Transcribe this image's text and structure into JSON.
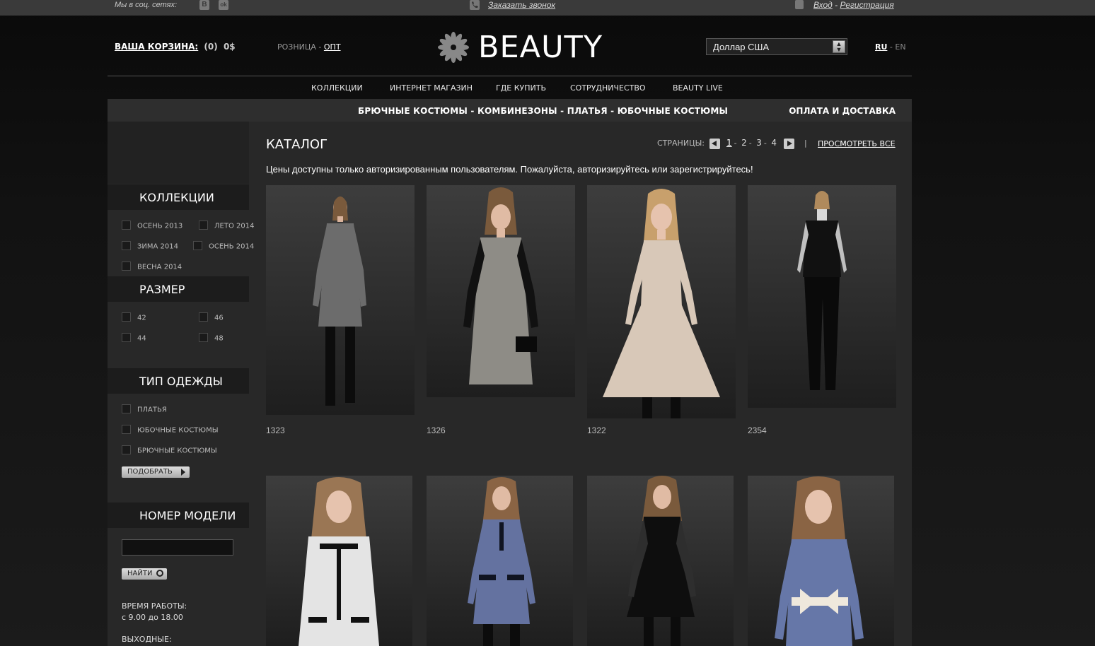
{
  "topbar": {
    "social_label": "Мы в соц. сетях:",
    "social_icons": [
      "В",
      "ok"
    ],
    "callback": "Заказать звонок",
    "login": "Вход",
    "separator": "-",
    "register": "Регистрация"
  },
  "header": {
    "cart_label": "ВАША КОРЗИНА:",
    "cart_count": "(0)",
    "cart_total": "0$",
    "retail": "РОЗНИЦА",
    "retail_sep": " - ",
    "wholesale": "ОПТ",
    "logo": "BEAUTY",
    "currency": "Доллар США",
    "lang_ru": "RU",
    "lang_sep": " - ",
    "lang_en": "EN"
  },
  "nav": [
    "КОЛЛЕКЦИИ",
    "ИНТЕРНЕТ МАГАЗИН",
    "ГДЕ КУПИТЬ",
    "СОТРУДНИЧЕСТВО",
    "BEAUTY LIVE"
  ],
  "categories": {
    "links": "БРЮЧНЫЕ КОСТЮМЫ - КОМБИНЕЗОНЫ - ПЛАТЬЯ - ЮБОЧНЫЕ КОСТЮМЫ",
    "delivery": "ОПЛАТА И ДОСТАВКА"
  },
  "sidebar": {
    "collections_title": "КОЛЛЕКЦИИ",
    "collections": [
      "ОСЕНЬ 2013",
      "ЛЕТО 2014",
      "ЗИМА 2014",
      "ОСЕНЬ 2014",
      "ВЕСНА 2014"
    ],
    "size_title": "РАЗМЕР",
    "sizes": [
      "42",
      "46",
      "44",
      "48"
    ],
    "type_title": "ТИП ОДЕЖДЫ",
    "types": [
      "ПЛАТЬЯ",
      "ЮБОЧНЫЕ КОСТЮМЫ",
      "БРЮЧНЫЕ КОСТЮМЫ"
    ],
    "pick_button": "ПОДОБРАТЬ",
    "model_title": "НОМЕР МОДЕЛИ",
    "model_input_value": "",
    "find_button": "НАЙТИ",
    "hours_label": "ВРЕМЯ РАБОТЫ:",
    "hours_value": "с 9.00 до 18.00",
    "weekend_label": "ВЫХОДНЫЕ:"
  },
  "catalog": {
    "title": "КАТАЛОГ",
    "pages_label": "СТРАНИЦЫ:",
    "pages": [
      "1",
      "2",
      "3",
      "4"
    ],
    "pages_sep": "-",
    "pages_bar": "|",
    "view_all": "ПРОСМОТРЕТЬ ВСЕ",
    "notice": "Цены доступны только авторизированным пользователям. Пожалуйста, авторизируйтесь или зарегистрируйтесь!",
    "products": [
      {
        "sku": "1323",
        "dress_color": "#6c6c6c",
        "style": "grey-shift"
      },
      {
        "sku": "1326",
        "dress_color": "#8e8c86",
        "style": "leather-sleeves"
      },
      {
        "sku": "1322",
        "dress_color": "#d8c8b8",
        "style": "beige-flare"
      },
      {
        "sku": "2354",
        "dress_color": "#111111",
        "style": "black-trousers"
      },
      {
        "sku": "",
        "dress_color": "#e4e4e4",
        "style": "white-trim"
      },
      {
        "sku": "",
        "dress_color": "#6472a0",
        "style": "blue-pockets"
      },
      {
        "sku": "",
        "dress_color": "#0e0e0e",
        "style": "black-lace"
      },
      {
        "sku": "",
        "dress_color": "#6677a8",
        "style": "blue-bow"
      }
    ]
  },
  "colors": {
    "page_bg": "#111111",
    "panel_bg": "#282828",
    "accent": "#ffffff"
  }
}
